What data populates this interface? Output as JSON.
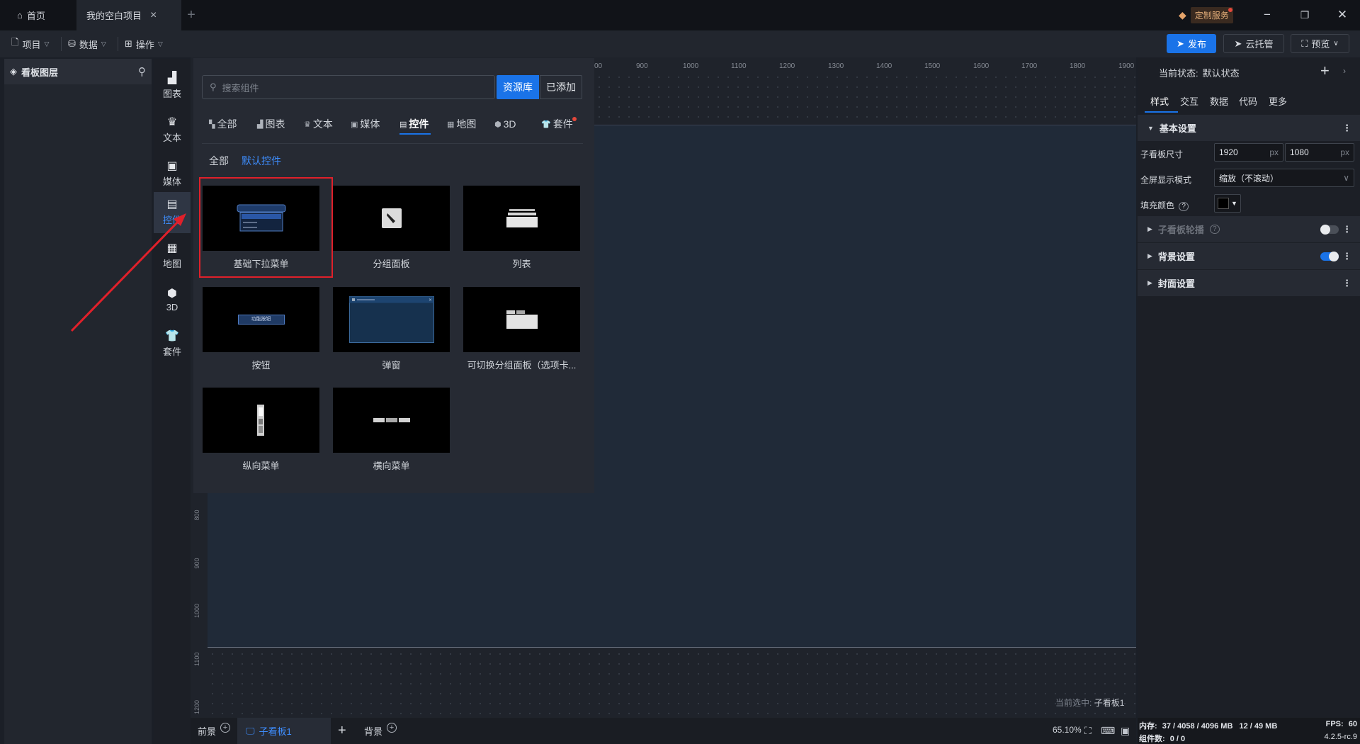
{
  "titlebar": {
    "home_tab": "首页",
    "project_tab": "我的空白项目",
    "custom_service": "定制服务"
  },
  "menubar": {
    "project": "项目",
    "data": "数据",
    "operate": "操作",
    "publish": "发布",
    "cloud": "云托管",
    "preview": "预览"
  },
  "layers": {
    "title": "看板图层"
  },
  "categories": [
    "图表",
    "文本",
    "媒体",
    "控件",
    "地图",
    "3D",
    "套件"
  ],
  "library": {
    "search_placeholder": "搜索组件",
    "tab_library": "资源库",
    "tab_added": "已添加",
    "types": [
      "全部",
      "图表",
      "文本",
      "媒体",
      "控件",
      "地图",
      "3D",
      "套件"
    ],
    "sub_all": "全部",
    "sub_default": "默认控件",
    "components": [
      "基础下拉菜单",
      "分组面板",
      "列表",
      "按钮",
      "弹窗",
      "可切换分组面板（选项卡...",
      "纵向菜单",
      "横向菜单"
    ],
    "button_thumb_text": "功能按钮"
  },
  "ruler": {
    "top": [
      "00",
      "900",
      "1000",
      "1100",
      "1200",
      "1300",
      "1400",
      "1500",
      "1600",
      "1700",
      "1800",
      "1900"
    ],
    "left": [
      "800",
      "900",
      "1000",
      "1100",
      "1200"
    ]
  },
  "canvas": {
    "current_selected_label": "当前选中:",
    "current_selected_value": "子看板1"
  },
  "bottombar": {
    "foreground": "前景",
    "subboard": "子看板1",
    "background": "背景",
    "zoom": "65.10%"
  },
  "rightpanel": {
    "state_label": "当前状态:",
    "state_value": "默认状态",
    "tabs": [
      "样式",
      "交互",
      "数据",
      "代码",
      "更多"
    ],
    "basic_settings": "基本设置",
    "size_label": "子看板尺寸",
    "width": "1920",
    "height": "1080",
    "unit": "px",
    "fullscreen_label": "全屏显示模式",
    "fullscreen_value": "缩放（不滚动）",
    "fill_label": "填充颜色",
    "fill_color": "#000000",
    "carousel": "子看板轮播",
    "carousel_on": false,
    "bg_settings": "背景设置",
    "bg_on": true,
    "cover_settings": "封面设置"
  },
  "status": {
    "mem_label": "内存:",
    "mem_value": "37 / 4058 / 4096 MB",
    "mem_value2": "12 / 49 MB",
    "fps_label": "FPS:",
    "fps_value": "60",
    "count_label": "组件数:",
    "count_value": "0 / 0",
    "version": "4.2.5-rc.9"
  },
  "colors": {
    "accent": "#1a73e8",
    "highlight": "#e0202a"
  }
}
